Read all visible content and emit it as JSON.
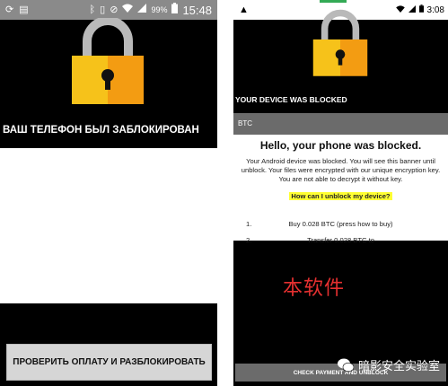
{
  "left_phone": {
    "status": {
      "left_icons": [
        "sync-icon",
        "document-icon"
      ],
      "right_icons": [
        "bluetooth-icon",
        "vibrate-icon",
        "no-sim-icon",
        "wifi-icon",
        "signal-icon"
      ],
      "battery": "99%",
      "time": "15:48"
    },
    "title": "ВАШ ТЕЛЕФОН БЫЛ ЗАБЛОКИРОВАН",
    "button_label": "ПРОВЕРИТЬ ОПЛАТУ И РАЗБЛОКИРОВАТЬ",
    "colors": {
      "background": "#000000",
      "button": "#d6d6d6",
      "lock_left": "#f6c21a",
      "lock_right": "#f39c12"
    }
  },
  "right_phone": {
    "status": {
      "left_icon": "warning-icon",
      "time": "3:08"
    },
    "title": "YOUR DEVICE WAS BLOCKED",
    "tab_label": "BTC",
    "heading": "Hello, your phone was blocked.",
    "message": "Your Android device was blocked. You will see this banner until unblock. Your files were encrypted with our unique encryption key. You are not able to decrypt it without key.",
    "link_label": "How can I unblock my device?",
    "steps": [
      {
        "num": "1.",
        "text": "Buy 0.028 BTC (press how to buy)"
      },
      {
        "num": "2.",
        "text": "Transfer 0.028 BTC to"
      }
    ],
    "overlay_text": "本软件",
    "button_label": "CHECK PAYMENT AND UNBLOCK",
    "colors": {
      "highlight": "#ffff33",
      "overlay_text": "#e53030",
      "bars": "#6b6b6b"
    }
  },
  "watermark": {
    "text": "暗影安全实验室"
  }
}
